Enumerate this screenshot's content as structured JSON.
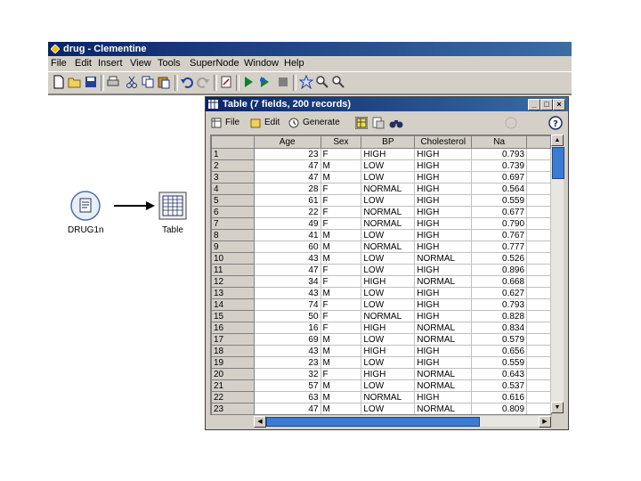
{
  "main_window": {
    "title": "drug - Clementine",
    "menu": [
      "File",
      "Edit",
      "Insert",
      "View",
      "Tools",
      "SuperNode",
      "Window",
      "Help"
    ]
  },
  "toolbar_icons": [
    "new-icon",
    "open-icon",
    "save-icon",
    "print-icon",
    "cut-icon",
    "copy-icon",
    "paste-icon",
    "undo-icon",
    "redo-icon",
    "edit-icon",
    "execute-icon",
    "execute-selection-icon",
    "stop-icon",
    "supernode-icon",
    "zoom-in-icon",
    "zoom-out-icon"
  ],
  "stream": {
    "source_node_label": "DRUG1n",
    "table_node_label": "Table"
  },
  "table_window": {
    "title": "Table (7 fields, 200 records)",
    "menu": {
      "file": "File",
      "edit": "Edit",
      "generate": "Generate"
    },
    "columns": [
      "",
      "Age",
      "Sex",
      "BP",
      "Cholesterol",
      "Na"
    ],
    "rows": [
      [
        "1",
        "23",
        "F",
        "HIGH",
        "HIGH",
        "0.793"
      ],
      [
        "2",
        "47",
        "M",
        "LOW",
        "HIGH",
        "0.739"
      ],
      [
        "3",
        "47",
        "M",
        "LOW",
        "HIGH",
        "0.697"
      ],
      [
        "4",
        "28",
        "F",
        "NORMAL",
        "HIGH",
        "0.564"
      ],
      [
        "5",
        "61",
        "F",
        "LOW",
        "HIGH",
        "0.559"
      ],
      [
        "6",
        "22",
        "F",
        "NORMAL",
        "HIGH",
        "0.677"
      ],
      [
        "7",
        "49",
        "F",
        "NORMAL",
        "HIGH",
        "0.790"
      ],
      [
        "8",
        "41",
        "M",
        "LOW",
        "HIGH",
        "0.767"
      ],
      [
        "9",
        "60",
        "M",
        "NORMAL",
        "HIGH",
        "0.777"
      ],
      [
        "10",
        "43",
        "M",
        "LOW",
        "NORMAL",
        "0.526"
      ],
      [
        "11",
        "47",
        "F",
        "LOW",
        "HIGH",
        "0.896"
      ],
      [
        "12",
        "34",
        "F",
        "HIGH",
        "NORMAL",
        "0.668"
      ],
      [
        "13",
        "43",
        "M",
        "LOW",
        "HIGH",
        "0.627"
      ],
      [
        "14",
        "74",
        "F",
        "LOW",
        "HIGH",
        "0.793"
      ],
      [
        "15",
        "50",
        "F",
        "NORMAL",
        "HIGH",
        "0.828"
      ],
      [
        "16",
        "16",
        "F",
        "HIGH",
        "NORMAL",
        "0.834"
      ],
      [
        "17",
        "69",
        "M",
        "LOW",
        "NORMAL",
        "0.579"
      ],
      [
        "18",
        "43",
        "M",
        "HIGH",
        "HIGH",
        "0.656"
      ],
      [
        "19",
        "23",
        "M",
        "LOW",
        "HIGH",
        "0.559"
      ],
      [
        "20",
        "32",
        "F",
        "HIGH",
        "NORMAL",
        "0.643"
      ],
      [
        "21",
        "57",
        "M",
        "LOW",
        "NORMAL",
        "0.537"
      ],
      [
        "22",
        "63",
        "M",
        "NORMAL",
        "HIGH",
        "0.616"
      ],
      [
        "23",
        "47",
        "M",
        "LOW",
        "NORMAL",
        "0.809"
      ]
    ]
  },
  "colors": {
    "title_bar": "#0a246a",
    "chrome": "#d4d0c8",
    "scroll_thumb": "#3a7bd5"
  }
}
